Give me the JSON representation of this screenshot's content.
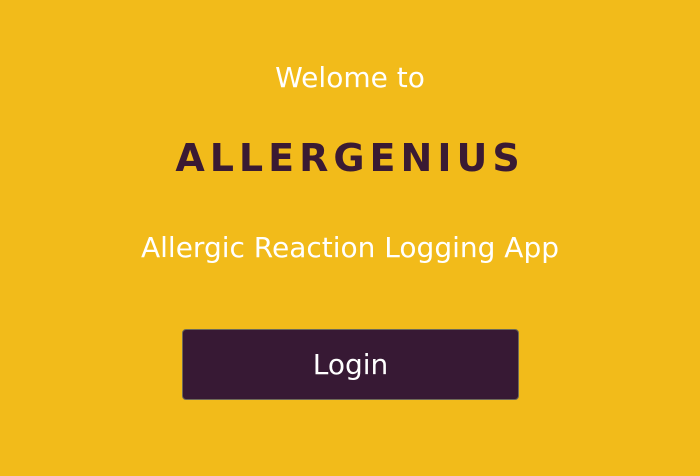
{
  "welcome": {
    "greeting": "Welome to",
    "app_name": "ALLERGENIUS",
    "tagline": "Allergic Reaction Logging App"
  },
  "actions": {
    "login_label": "Login"
  },
  "colors": {
    "background": "#F2BB1A",
    "brand_text": "#3A1A33",
    "button_background": "#371934",
    "text_light": "#FFFFFF"
  }
}
